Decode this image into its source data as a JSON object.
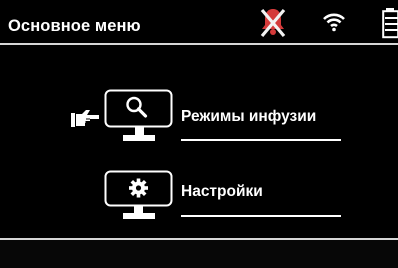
{
  "header": {
    "title": "Основное меню",
    "status_icons": [
      "alarm-disabled-icon",
      "wifi-icon",
      "battery-icon"
    ]
  },
  "menu": {
    "items": [
      {
        "label": "Режимы инфузии",
        "icon": "search-monitor-icon",
        "selected": true
      },
      {
        "label": "Настройки",
        "icon": "settings-monitor-icon",
        "selected": false
      }
    ],
    "pointer_icon": "pointing-hand-icon"
  },
  "colors": {
    "background": "#000000",
    "text": "#ffffff",
    "alarm_bell": "#d43a3a"
  }
}
